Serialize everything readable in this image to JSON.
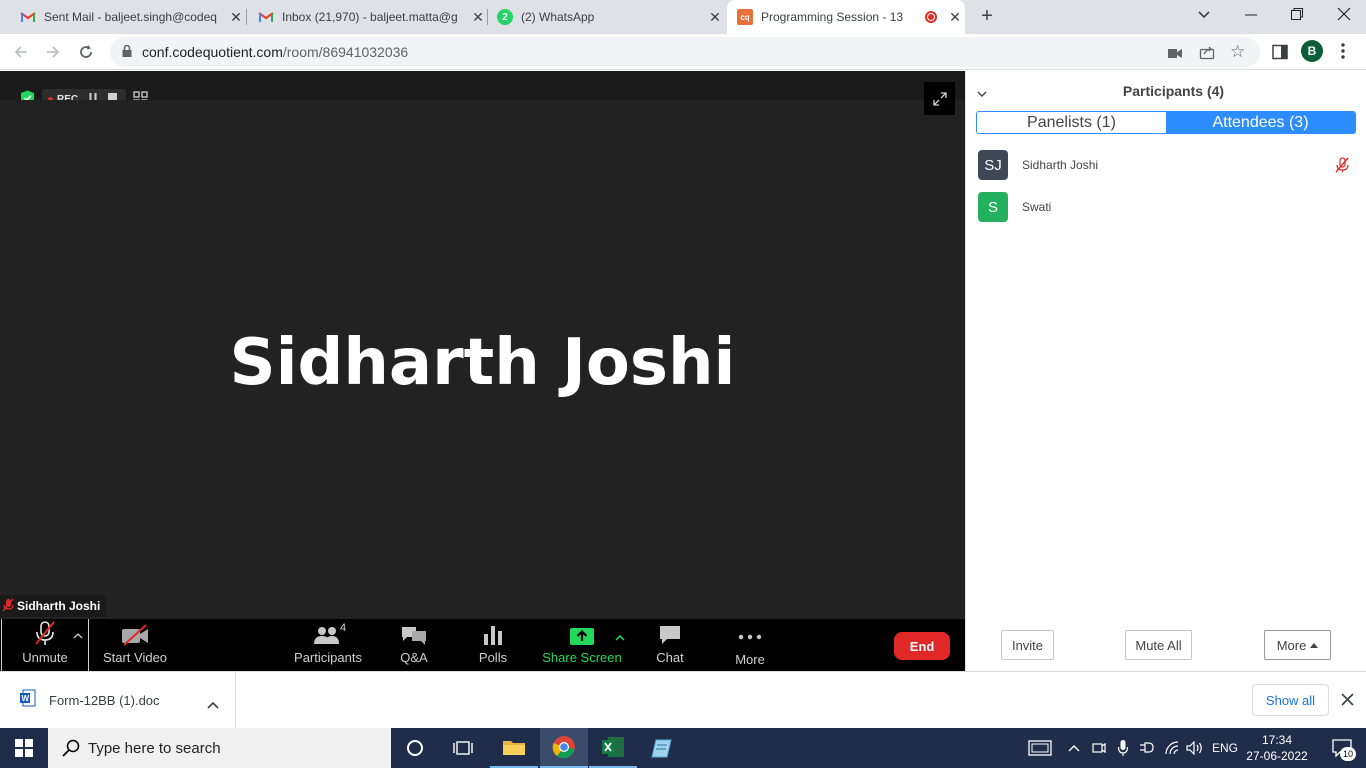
{
  "tabs": [
    {
      "title": "Sent Mail - baljeet.singh@codeq",
      "icon": "gmail-icon"
    },
    {
      "title": "Inbox (21,970) - baljeet.matta@g",
      "icon": "gmail-icon"
    },
    {
      "title": "(2) WhatsApp",
      "icon": "whatsapp-icon",
      "badge": "2"
    },
    {
      "title": "Programming Session - 13",
      "icon": "codequotient-icon",
      "favicon_text": "cq"
    }
  ],
  "address": {
    "domain": "conf.codequotient.com",
    "path": "/room/86941032036"
  },
  "profile_initial": "B",
  "meeting": {
    "rec_label": "REC",
    "speaker_name": "Sidharth Joshi",
    "name_tag": "Sidharth Joshi"
  },
  "controls": {
    "unmute": "Unmute",
    "start_video": "Start Video",
    "participants": "Participants",
    "participants_count": "4",
    "qa": "Q&A",
    "polls": "Polls",
    "share_screen": "Share Screen",
    "chat": "Chat",
    "more": "More",
    "end": "End"
  },
  "panel": {
    "title": "Participants (4)",
    "tab_panelists": "Panelists (1)",
    "tab_attendees": "Attendees (3)",
    "attendees": [
      {
        "initials": "SJ",
        "name": "Sidharth Joshi",
        "avatar_color": "#3d4756",
        "muted": true
      },
      {
        "initials": "S",
        "name": "Swati",
        "avatar_color": "#23b15f",
        "muted": false
      }
    ],
    "invite": "Invite",
    "mute_all": "Mute All",
    "more": "More"
  },
  "download": {
    "filename": "Form-12BB (1).doc",
    "show_all": "Show all"
  },
  "taskbar": {
    "search_placeholder": "Type here to search",
    "lang": "ENG",
    "time": "17:34",
    "date": "27-06-2022",
    "notification_count": "10"
  },
  "colors": {
    "accent_blue": "#2d8cff",
    "end_red": "#e02828",
    "share_green": "#23d959"
  }
}
